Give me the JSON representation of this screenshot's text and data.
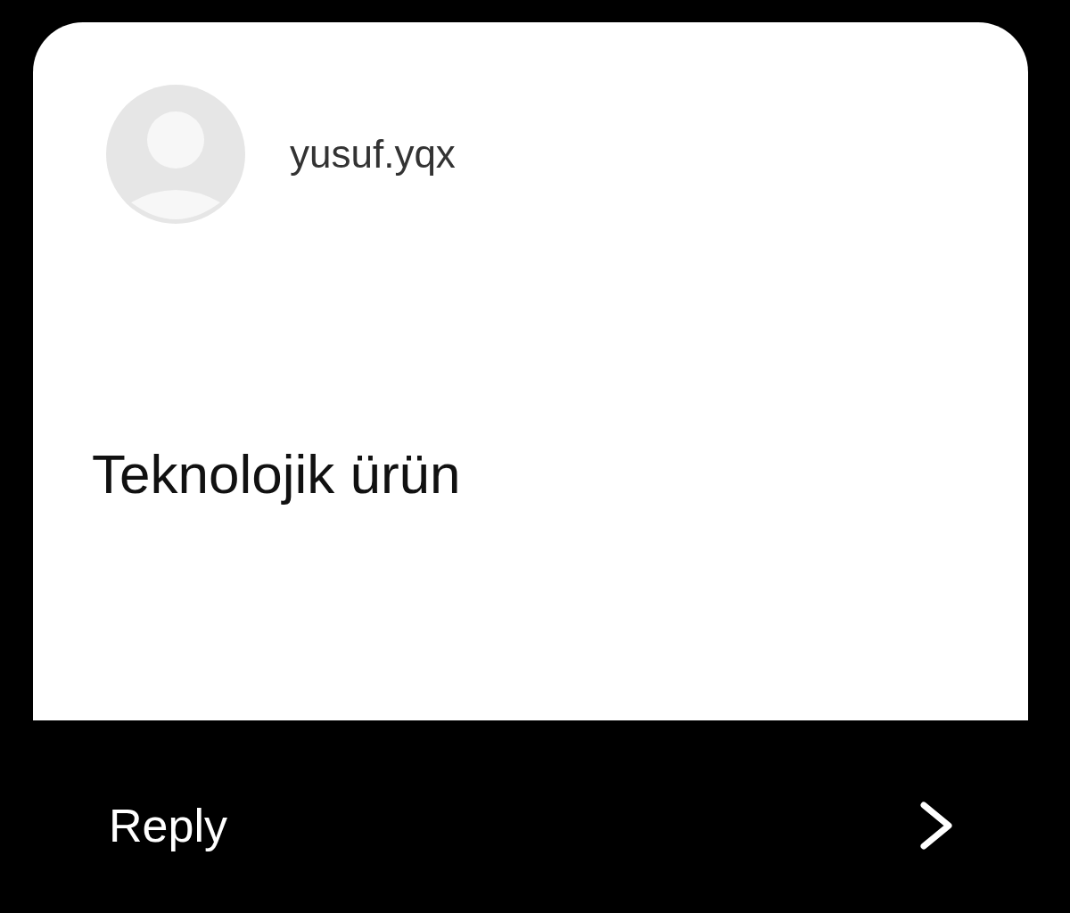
{
  "sender": {
    "name": "yusuf.yqx"
  },
  "message": {
    "text": "Teknolojik ürün"
  },
  "reply": {
    "label": "Reply"
  }
}
